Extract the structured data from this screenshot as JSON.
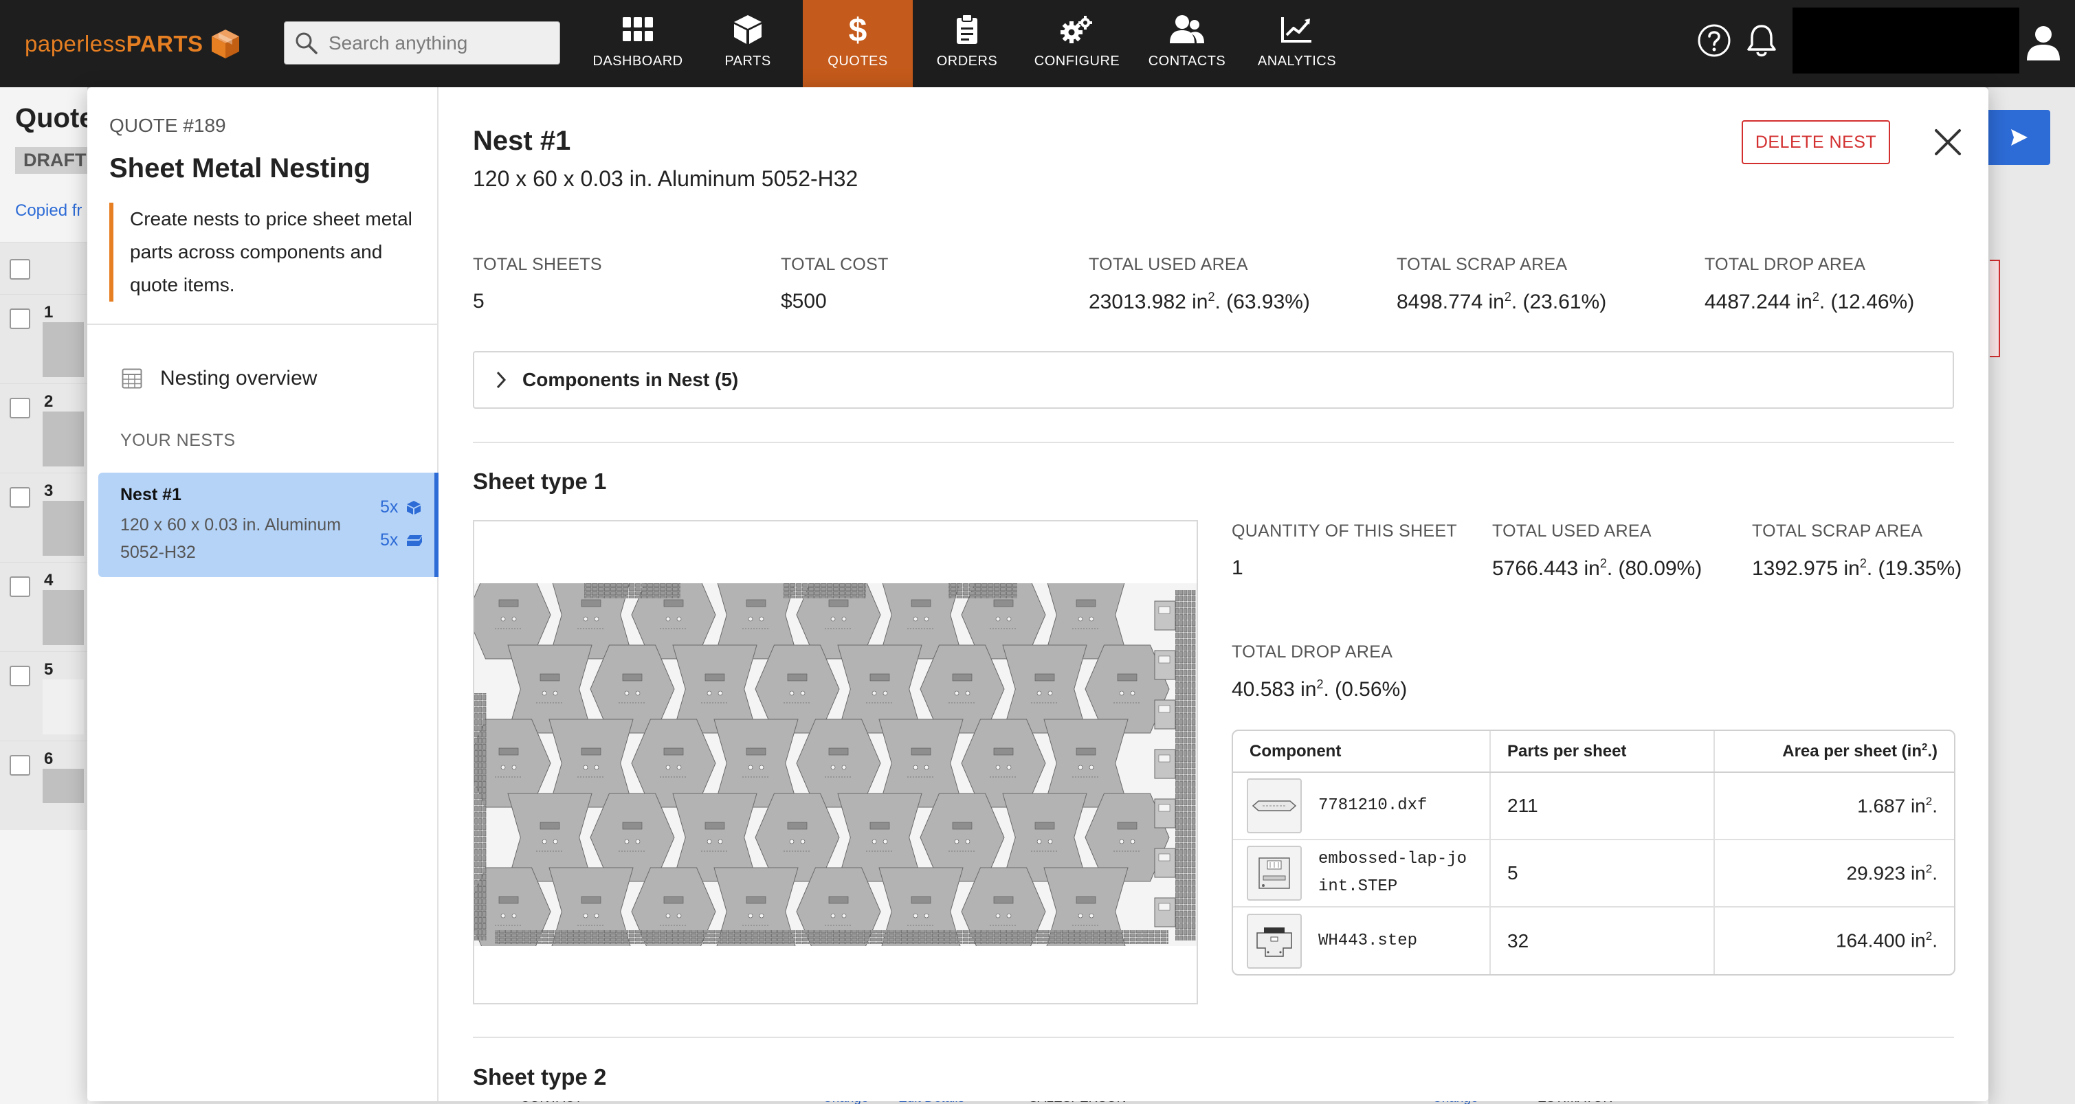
{
  "app": {
    "logo_light": "paperless",
    "logo_bold": "PARTS",
    "brand_color": "#e67e22",
    "active_color": "#c45a1b"
  },
  "search": {
    "placeholder": "Search anything"
  },
  "nav": [
    {
      "label": "DASHBOARD",
      "icon": "dashboard-grid-icon"
    },
    {
      "label": "PARTS",
      "icon": "cube-icon"
    },
    {
      "label": "QUOTES",
      "icon": "dollar-icon",
      "active": true
    },
    {
      "label": "ORDERS",
      "icon": "clipboard-icon"
    },
    {
      "label": "CONFIGURE",
      "icon": "gears-icon"
    },
    {
      "label": "CONTACTS",
      "icon": "contacts-icon"
    },
    {
      "label": "ANALYTICS",
      "icon": "chart-icon"
    }
  ],
  "background": {
    "title": "Quote",
    "status": "DRAFT",
    "copied": "Copied fr",
    "rows": [
      "1",
      "2",
      "3",
      "4",
      "5",
      "6"
    ],
    "bottom": [
      "CONTACT",
      "Change",
      "Edit Details",
      "SALESPERSON",
      "Change",
      "ESTIMATOR"
    ]
  },
  "modal": {
    "sidebar": {
      "quote_number": "QUOTE #189",
      "title": "Sheet Metal Nesting",
      "description": "Create nests to price sheet metal parts across components and quote items.",
      "overview_label": "Nesting overview",
      "your_nests_label": "YOUR NESTS",
      "nests": [
        {
          "title": "Nest #1",
          "desc": "120 x 60 x 0.03 in. Aluminum 5052-H32",
          "qty_parts": "5x",
          "qty_sheets": "5x"
        }
      ]
    },
    "main": {
      "title": "Nest #1",
      "subtitle": "120 x 60 x 0.03 in. Aluminum 5052-H32",
      "delete_label": "DELETE NEST",
      "stats": [
        {
          "label": "TOTAL SHEETS",
          "value": "5",
          "unit": "",
          "pct": ""
        },
        {
          "label": "TOTAL COST",
          "value": "$500",
          "unit": "",
          "pct": ""
        },
        {
          "label": "TOTAL USED AREA",
          "value": "23013.982 in",
          "unit": "2",
          "pct": ". (63.93%)"
        },
        {
          "label": "TOTAL SCRAP AREA",
          "value": "8498.774 in",
          "unit": "2",
          "pct": ". (23.61%)"
        },
        {
          "label": "TOTAL DROP AREA",
          "value": "4487.244 in",
          "unit": "2",
          "pct": ". (12.46%)"
        }
      ],
      "components_label": "Components in Nest (5)",
      "sheet_type_1": {
        "title": "Sheet type 1",
        "stats": [
          {
            "label": "QUANTITY OF THIS SHEET",
            "value": "1",
            "unit": "",
            "pct": ""
          },
          {
            "label": "TOTAL USED AREA",
            "value": "5766.443 in",
            "unit": "2",
            "pct": ". (80.09%)"
          },
          {
            "label": "TOTAL SCRAP AREA",
            "value": "1392.975 in",
            "unit": "2",
            "pct": ". (19.35%)"
          },
          {
            "label": "TOTAL DROP AREA",
            "value": "40.583 in",
            "unit": "2",
            "pct": ". (0.56%)"
          }
        ],
        "table": {
          "headers": [
            "Component",
            "Parts per sheet",
            "Area per sheet (in",
            "2",
            ".)"
          ],
          "rows": [
            {
              "name": "7781210.dxf",
              "parts": "211",
              "area": "1.687 in",
              "unit": "2",
              "suffix": "."
            },
            {
              "name": "embossed-lap-joint.STEP",
              "parts": "5",
              "area": "29.923 in",
              "unit": "2",
              "suffix": "."
            },
            {
              "name": "WH443.step",
              "parts": "32",
              "area": "164.400 in",
              "unit": "2",
              "suffix": "."
            }
          ]
        }
      },
      "sheet_type_2": {
        "title": "Sheet type 2"
      }
    }
  }
}
